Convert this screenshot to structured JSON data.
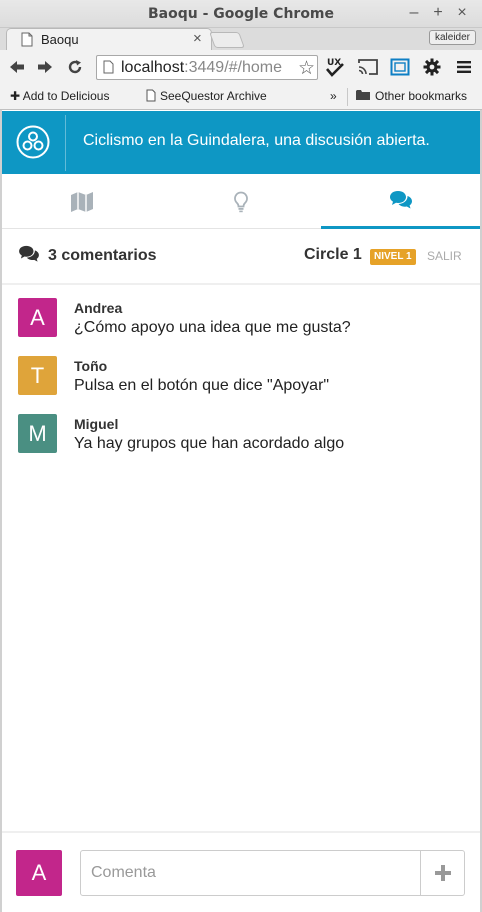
{
  "window": {
    "title": "Baoqu - Google Chrome",
    "minimize": "–",
    "maximize": "+",
    "close": "×"
  },
  "tab": {
    "title": "Baoqu",
    "close": "×"
  },
  "profile": {
    "name": "kaleider"
  },
  "address": {
    "host": "localhost",
    "rest": ":3449/#/home"
  },
  "bookmarks": {
    "items": [
      {
        "label": "Add to Delicious",
        "icon": "plus-icon"
      },
      {
        "label": "SeeQuestor Archive",
        "icon": "page-icon"
      }
    ],
    "overflow": "»",
    "other": "Other bookmarks"
  },
  "app": {
    "header_title": "Ciclismo en la Guindalera, una discusión abierta.",
    "accent_color": "#0e97c4",
    "nav_tabs": [
      {
        "icon": "map-icon",
        "active": false
      },
      {
        "icon": "lightbulb-icon",
        "active": false
      },
      {
        "icon": "comments-icon",
        "active": true
      }
    ]
  },
  "section": {
    "comments_label": "3 comentarios",
    "circle_name": "Circle 1",
    "level_badge": "NIVEL 1",
    "logout": "SALIR"
  },
  "comments": [
    {
      "initial": "A",
      "author": "Andrea",
      "text": "¿Cómo apoyo una idea que me gusta?",
      "color": "#c2268b"
    },
    {
      "initial": "T",
      "author": "Toño",
      "text": "Pulsa en el botón que dice \"Apoyar\"",
      "color": "#dfa43a"
    },
    {
      "initial": "M",
      "author": "Miguel",
      "text": "Ya hay grupos que han acordado algo",
      "color": "#4a8f82"
    }
  ],
  "composer": {
    "initial": "A",
    "avatar_color": "#c2268b",
    "placeholder": "Comenta",
    "add_icon": "plus-icon"
  }
}
